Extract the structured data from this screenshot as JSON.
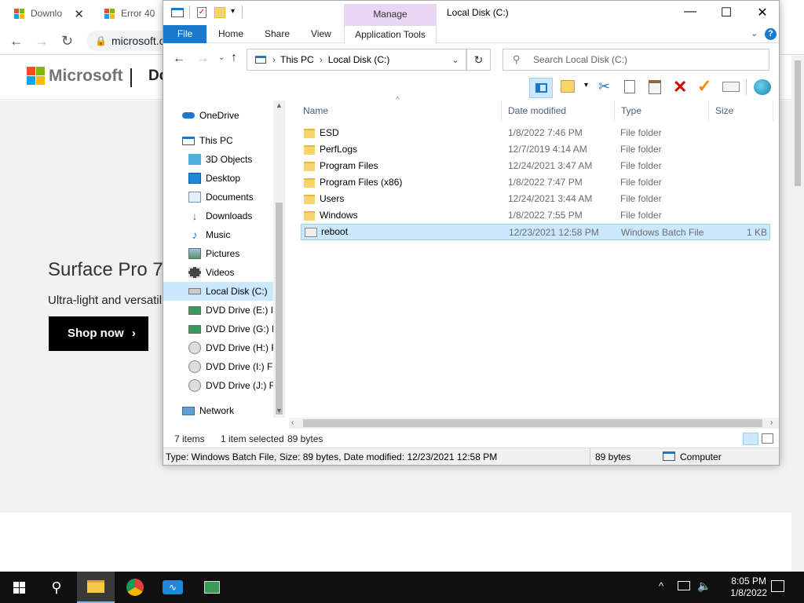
{
  "browser": {
    "tabs": [
      {
        "label": "Downlo",
        "close": "✕"
      },
      {
        "label": "Error 40",
        "close": "✕"
      }
    ],
    "url": "microsoft.c",
    "ms_logo_text": "Microsoft",
    "header_fragment": "Do",
    "hero_title": "Surface Pro 7",
    "hero_subtitle": "Ultra-light and versatil",
    "shop_now": "Shop now"
  },
  "explorer": {
    "title": "Local Disk (C:)",
    "manage_label": "Manage",
    "ribbon_tabs": [
      "File",
      "Home",
      "Share",
      "View",
      "Application Tools"
    ],
    "breadcrumb": [
      "This PC",
      "Local Disk (C:)"
    ],
    "search_placeholder": "Search Local Disk (C:)",
    "nav": [
      {
        "label": "OneDrive",
        "icon": "cloud-icon"
      },
      {
        "label": "This PC",
        "icon": "computer-icon"
      },
      {
        "label": "3D Objects",
        "icon": "cube-icon"
      },
      {
        "label": "Desktop",
        "icon": "desktop-icon"
      },
      {
        "label": "Documents",
        "icon": "documents-icon"
      },
      {
        "label": "Downloads",
        "icon": "download-arrow-icon"
      },
      {
        "label": "Music",
        "icon": "music-note-icon"
      },
      {
        "label": "Pictures",
        "icon": "pictures-icon"
      },
      {
        "label": "Videos",
        "icon": "film-icon"
      },
      {
        "label": "Local Disk (C:)",
        "icon": "drive-icon"
      },
      {
        "label": "DVD Drive (E:) IR",
        "icon": "dvd-drive-icon"
      },
      {
        "label": "DVD Drive (G:) ES",
        "icon": "dvd-drive-icon"
      },
      {
        "label": "DVD Drive (H:) F",
        "icon": "disc-icon"
      },
      {
        "label": "DVD Drive (I:) FR",
        "icon": "disc-icon"
      },
      {
        "label": "DVD Drive (J:) FR",
        "icon": "disc-icon"
      },
      {
        "label": "Network",
        "icon": "network-icon"
      }
    ],
    "columns": [
      "Name",
      "Date modified",
      "Type",
      "Size"
    ],
    "files": [
      {
        "name": "ESD",
        "date": "1/8/2022 7:46 PM",
        "type": "File folder",
        "size": ""
      },
      {
        "name": "PerfLogs",
        "date": "12/7/2019 4:14 AM",
        "type": "File folder",
        "size": ""
      },
      {
        "name": "Program Files",
        "date": "12/24/2021 3:47 AM",
        "type": "File folder",
        "size": ""
      },
      {
        "name": "Program Files (x86)",
        "date": "1/8/2022 7:47 PM",
        "type": "File folder",
        "size": ""
      },
      {
        "name": "Users",
        "date": "12/24/2021 3:44 AM",
        "type": "File folder",
        "size": ""
      },
      {
        "name": "Windows",
        "date": "1/8/2022 7:55 PM",
        "type": "File folder",
        "size": ""
      },
      {
        "name": "reboot",
        "date": "12/23/2021 12:58 PM",
        "type": "Windows Batch File",
        "size": "1 KB"
      }
    ],
    "status": {
      "items": "7 items",
      "selected": "1 item selected",
      "bytes": "89 bytes"
    },
    "details": {
      "info": "Type: Windows Batch File, Size: 89 bytes, Date modified: 12/23/2021 12:58 PM",
      "size": "89 bytes",
      "location": "Computer"
    }
  },
  "taskbar": {
    "time": "8:05 PM",
    "date": "1/8/2022"
  },
  "colors": {
    "accent": "#1979ca",
    "selection": "#cce8ff",
    "manage": "#e9d6f5",
    "delete": "#d40000",
    "check": "#f08a00"
  }
}
